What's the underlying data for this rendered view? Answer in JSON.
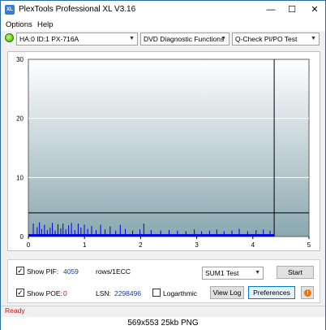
{
  "window": {
    "title": "PlexTools Professional XL V3.16",
    "app_icon_text": "XL",
    "min_glyph": "—",
    "max_glyph": "☐",
    "close_glyph": "✕"
  },
  "menu": {
    "options_label": "Options",
    "help_label": "Help"
  },
  "toolbar": {
    "drive_label": "HA:0 ID:1  PX-716A",
    "function_label": "DVD Diagnostic Functions",
    "test_label": "Q-Check PI/PO Test"
  },
  "chart_data": {
    "type": "bar",
    "y_ticks": [
      "30",
      "20",
      "10",
      "0"
    ],
    "x_ticks": [
      "0",
      "1",
      "2",
      "3",
      "4",
      "5"
    ],
    "ylim": [
      0,
      30
    ],
    "xlim": [
      0,
      5
    ],
    "threshold_line": 4,
    "end_marker_x": 4.38,
    "pif_spikes": [
      {
        "x": 0.08,
        "y": 2.2
      },
      {
        "x": 0.15,
        "y": 1.6
      },
      {
        "x": 0.19,
        "y": 2.4
      },
      {
        "x": 0.23,
        "y": 1.3
      },
      {
        "x": 0.28,
        "y": 2.0
      },
      {
        "x": 0.33,
        "y": 1.1
      },
      {
        "x": 0.38,
        "y": 1.5
      },
      {
        "x": 0.42,
        "y": 2.3
      },
      {
        "x": 0.47,
        "y": 1.0
      },
      {
        "x": 0.52,
        "y": 2.1
      },
      {
        "x": 0.57,
        "y": 1.4
      },
      {
        "x": 0.61,
        "y": 2.2
      },
      {
        "x": 0.66,
        "y": 1.2
      },
      {
        "x": 0.71,
        "y": 1.9
      },
      {
        "x": 0.76,
        "y": 2.3
      },
      {
        "x": 0.82,
        "y": 1.1
      },
      {
        "x": 0.88,
        "y": 2.2
      },
      {
        "x": 0.93,
        "y": 1.5
      },
      {
        "x": 0.99,
        "y": 2.0
      },
      {
        "x": 1.05,
        "y": 1.3
      },
      {
        "x": 1.12,
        "y": 1.8
      },
      {
        "x": 1.2,
        "y": 1.1
      },
      {
        "x": 1.28,
        "y": 2.0
      },
      {
        "x": 1.36,
        "y": 1.2
      },
      {
        "x": 1.45,
        "y": 1.7
      },
      {
        "x": 1.55,
        "y": 1.0
      },
      {
        "x": 1.63,
        "y": 2.0
      },
      {
        "x": 1.72,
        "y": 1.3
      },
      {
        "x": 1.85,
        "y": 1.0
      },
      {
        "x": 1.98,
        "y": 1.2
      },
      {
        "x": 2.05,
        "y": 2.2
      },
      {
        "x": 2.18,
        "y": 1.1
      },
      {
        "x": 2.35,
        "y": 1.0
      },
      {
        "x": 2.5,
        "y": 1.1
      },
      {
        "x": 2.65,
        "y": 1.0
      },
      {
        "x": 2.8,
        "y": 0.9
      },
      {
        "x": 2.95,
        "y": 1.2
      },
      {
        "x": 3.08,
        "y": 0.9
      },
      {
        "x": 3.22,
        "y": 1.0
      },
      {
        "x": 3.35,
        "y": 1.2
      },
      {
        "x": 3.48,
        "y": 0.9
      },
      {
        "x": 3.62,
        "y": 1.0
      },
      {
        "x": 3.75,
        "y": 1.3
      },
      {
        "x": 3.9,
        "y": 0.9
      },
      {
        "x": 4.05,
        "y": 1.1
      },
      {
        "x": 4.18,
        "y": 1.2
      },
      {
        "x": 4.3,
        "y": 1.0
      }
    ],
    "base_fill_height": 0.4,
    "colors": {
      "plot_top": "#ffffff",
      "plot_bottom": "#8aa8b0",
      "bars": "#0000e0",
      "grid": "#ffffff",
      "line": "#000000"
    }
  },
  "controls": {
    "show_pif_label": "Show PIF:",
    "pif_value": "4059",
    "pif_unit": "rows/1ECC",
    "show_poe_label": "Show POE:",
    "poe_value": "0",
    "lsn_label": "LSN:",
    "lsn_value": "2298496",
    "logarithmic_label": "Logarthmic",
    "sum_select_value": "SUM1 Test",
    "start_label": "Start",
    "view_log_label": "View Log",
    "preferences_label": "Preferences",
    "info_glyph": "i",
    "check_glyph": "✓"
  },
  "status": {
    "text": "Ready"
  },
  "caption": {
    "text": "569x553  25kb  PNG"
  }
}
